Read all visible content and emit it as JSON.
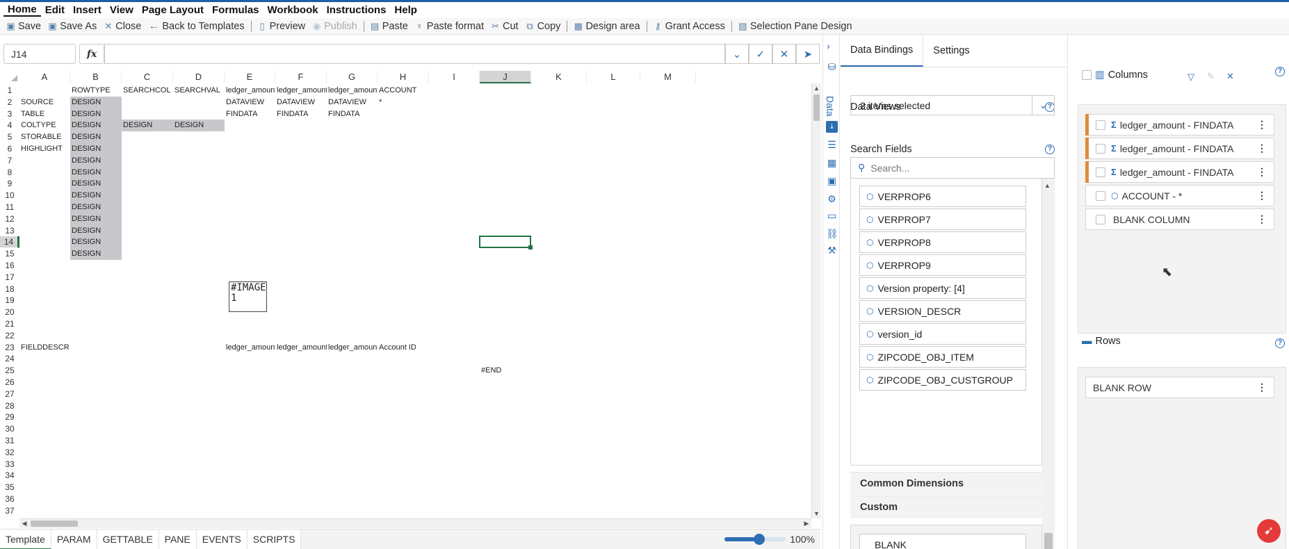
{
  "menu": [
    "Home",
    "Edit",
    "Insert",
    "View",
    "Page Layout",
    "Formulas",
    "Workbook",
    "Instructions",
    "Help"
  ],
  "toolbar": {
    "save": "Save",
    "save_as": "Save As",
    "close": "Close",
    "back": "Back to Templates",
    "preview": "Preview",
    "publish": "Publish",
    "paste": "Paste",
    "paste_format": "Paste format",
    "cut": "Cut",
    "copy": "Copy",
    "design_area": "Design area",
    "grant_access": "Grant Access",
    "selection_pane": "Selection Pane Design"
  },
  "formula": {
    "name_box": "J14",
    "fx": "fx",
    "value": ""
  },
  "grid": {
    "columns": [
      "A",
      "B",
      "C",
      "D",
      "E",
      "F",
      "G",
      "H",
      "I",
      "J",
      "K",
      "L",
      "M"
    ],
    "rows": [
      "1",
      "2",
      "3",
      "4",
      "5",
      "6",
      "7",
      "8",
      "9",
      "10",
      "11",
      "12",
      "13",
      "14",
      "15",
      "16",
      "17",
      "18",
      "19",
      "20",
      "21",
      "22",
      "23",
      "24",
      "25",
      "26",
      "27",
      "28",
      "29",
      "30",
      "31",
      "32",
      "33",
      "34",
      "35",
      "36",
      "37"
    ],
    "selected_col": "J",
    "selected_row": "14",
    "cells": {
      "B1": "ROWTYPE",
      "C1": "SEARCHCOL",
      "D1": "SEARCHVAL",
      "E1": "ledger_amount",
      "F1": "ledger_amount",
      "G1": "ledger_amount",
      "H1": "ACCOUNT",
      "A2": "SOURCE",
      "B2": "DESIGN",
      "E2": "DATAVIEW",
      "F2": "DATAVIEW",
      "G2": "DATAVIEW",
      "H2": "*",
      "A3": "TABLE",
      "B3": "DESIGN",
      "E3": "FINDATA",
      "F3": "FINDATA",
      "G3": "FINDATA",
      "A4": "COLTYPE",
      "B4": "DESIGN",
      "C4": "DESIGN",
      "D4": "DESIGN",
      "A5": "STORABLE",
      "B5": "DESIGN",
      "A6": "HIGHLIGHT",
      "B6": "DESIGN",
      "B7": "DESIGN",
      "B8": "DESIGN",
      "B9": "DESIGN",
      "B10": "DESIGN",
      "B11": "DESIGN",
      "B12": "DESIGN",
      "B13": "DESIGN",
      "B14": "DESIGN",
      "B15": "DESIGN",
      "A23": "FIELDDESCR",
      "E23": "ledger_amount",
      "F23": "ledger_amount",
      "G23": "ledger_amount",
      "H23": "Account ID",
      "J25": "#END"
    },
    "image_placeholder": {
      "line1": "#IMAGE",
      "line2": "1"
    }
  },
  "sheet_tabs": [
    "Template",
    "PARAM",
    "GETTABLE",
    "PANE",
    "EVENTS",
    "SCRIPTS"
  ],
  "zoom": {
    "label": "100%",
    "level": 0.5
  },
  "side_strip_label": "Data",
  "data_panel": {
    "tabs": [
      "Data Bindings",
      "Settings"
    ],
    "data_views_label": "Data Views",
    "data_views_value": "2 items selected",
    "search_fields_label": "Search Fields",
    "search_placeholder": "Search...",
    "fields": [
      "VERPROP6",
      "VERPROP7",
      "VERPROP8",
      "VERPROP9",
      "Version property: [4]",
      "VERSION_DESCR",
      "version_id",
      "ZIPCODE_OBJ_ITEM",
      "ZIPCODE_OBJ_CUSTGROUP"
    ],
    "sections": [
      "Common Dimensions",
      "Custom"
    ],
    "blank_item": "BLANK"
  },
  "columns_panel": {
    "title": "Columns",
    "items": [
      {
        "label": "ledger_amount - FINDATA",
        "kind": "measure"
      },
      {
        "label": "ledger_amount - FINDATA",
        "kind": "measure"
      },
      {
        "label": "ledger_amount - FINDATA",
        "kind": "measure"
      },
      {
        "label": "ACCOUNT - *",
        "kind": "dimension"
      },
      {
        "label": "BLANK COLUMN",
        "kind": "blank"
      }
    ]
  },
  "rows_panel": {
    "title": "Rows",
    "items": [
      "BLANK ROW"
    ]
  },
  "colors": {
    "accent": "#2c6eb1",
    "selection": "#217346",
    "measure_marker": "#e08a3a",
    "design_fill": "#c8c8cc",
    "fab": "#e53a3a"
  }
}
